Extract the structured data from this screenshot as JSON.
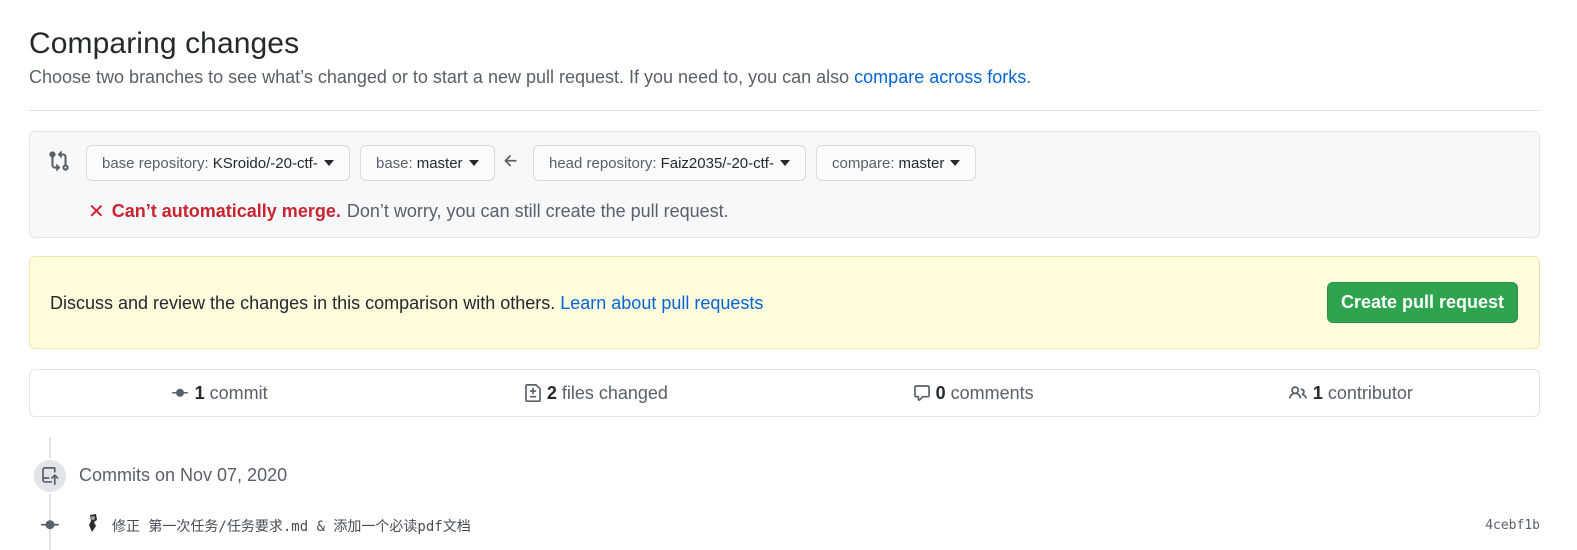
{
  "header": {
    "title": "Comparing changes",
    "subtitle": "Choose two branches to see what’s changed or to start a new pull request. If you need to, you can also ",
    "forks_link": "compare across forks",
    "subtitle_end": "."
  },
  "range": {
    "base_repo_label": "base repository:",
    "base_repo_value": "KSroido/-20-ctf-",
    "base_label": "base:",
    "base_value": "master",
    "head_repo_label": "head repository:",
    "head_repo_value": "Faiz2035/-20-ctf-",
    "compare_label": "compare:",
    "compare_value": "master",
    "merge_x": "✕",
    "merge_bad": "Can’t automatically merge.",
    "merge_note": "Don’t worry, you can still create the pull request."
  },
  "flash": {
    "message": "Discuss and review the changes in this comparison with others. ",
    "link": "Learn about pull requests",
    "button": "Create pull request"
  },
  "stats": {
    "commits_num": "1",
    "commits_label": "commit",
    "files_num": "2",
    "files_label": "files changed",
    "comments_num": "0",
    "comments_label": "comments",
    "contributors_num": "1",
    "contributors_label": "contributor"
  },
  "timeline": {
    "group_title": "Commits on Nov 07, 2020",
    "commits": [
      {
        "message": "修正 第一次任务/任务要求.md & 添加一个必读pdf文档",
        "sha": "4cebf1b"
      }
    ]
  },
  "colors": {
    "link": "#0366d6",
    "error": "#cb2431",
    "primary_button": "#2ea44f",
    "flash_bg": "#fffbdd"
  }
}
